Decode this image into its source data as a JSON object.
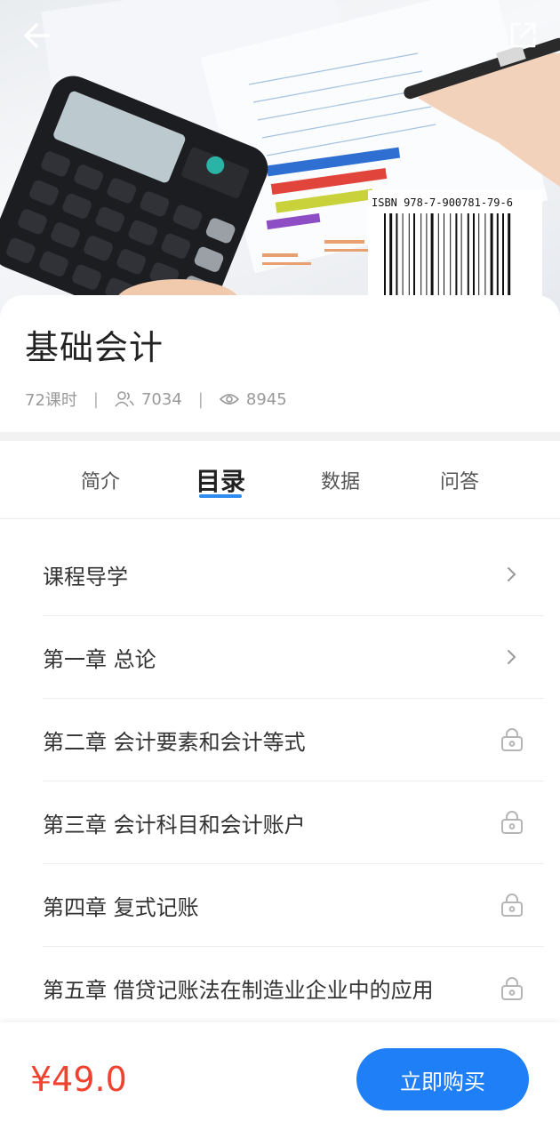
{
  "hero": {
    "isbn": "ISBN 978-7-900781-79-6",
    "back_icon": "arrow-left-icon",
    "share_icon": "external-link-icon"
  },
  "course": {
    "title": "基础会计",
    "hours": "72课时",
    "learners": "7034",
    "views": "8945"
  },
  "tabs": [
    {
      "label": "简介",
      "active": false
    },
    {
      "label": "目录",
      "active": true
    },
    {
      "label": "数据",
      "active": false
    },
    {
      "label": "问答",
      "active": false
    }
  ],
  "chapters": [
    {
      "label": "课程导学",
      "status": "open"
    },
    {
      "label": "第一章 总论",
      "status": "open"
    },
    {
      "label": "第二章 会计要素和会计等式",
      "status": "locked"
    },
    {
      "label": "第三章 会计科目和会计账户",
      "status": "locked"
    },
    {
      "label": "第四章 复式记账",
      "status": "locked"
    },
    {
      "label": "第五章 借贷记账法在制造业企业中的应用",
      "status": "locked"
    }
  ],
  "purchase": {
    "price": "¥49.0",
    "buy_label": "立即购买"
  },
  "colors": {
    "accent": "#1e7ff6",
    "price": "#f0432f",
    "tab_underline": "#2d8cf0"
  }
}
